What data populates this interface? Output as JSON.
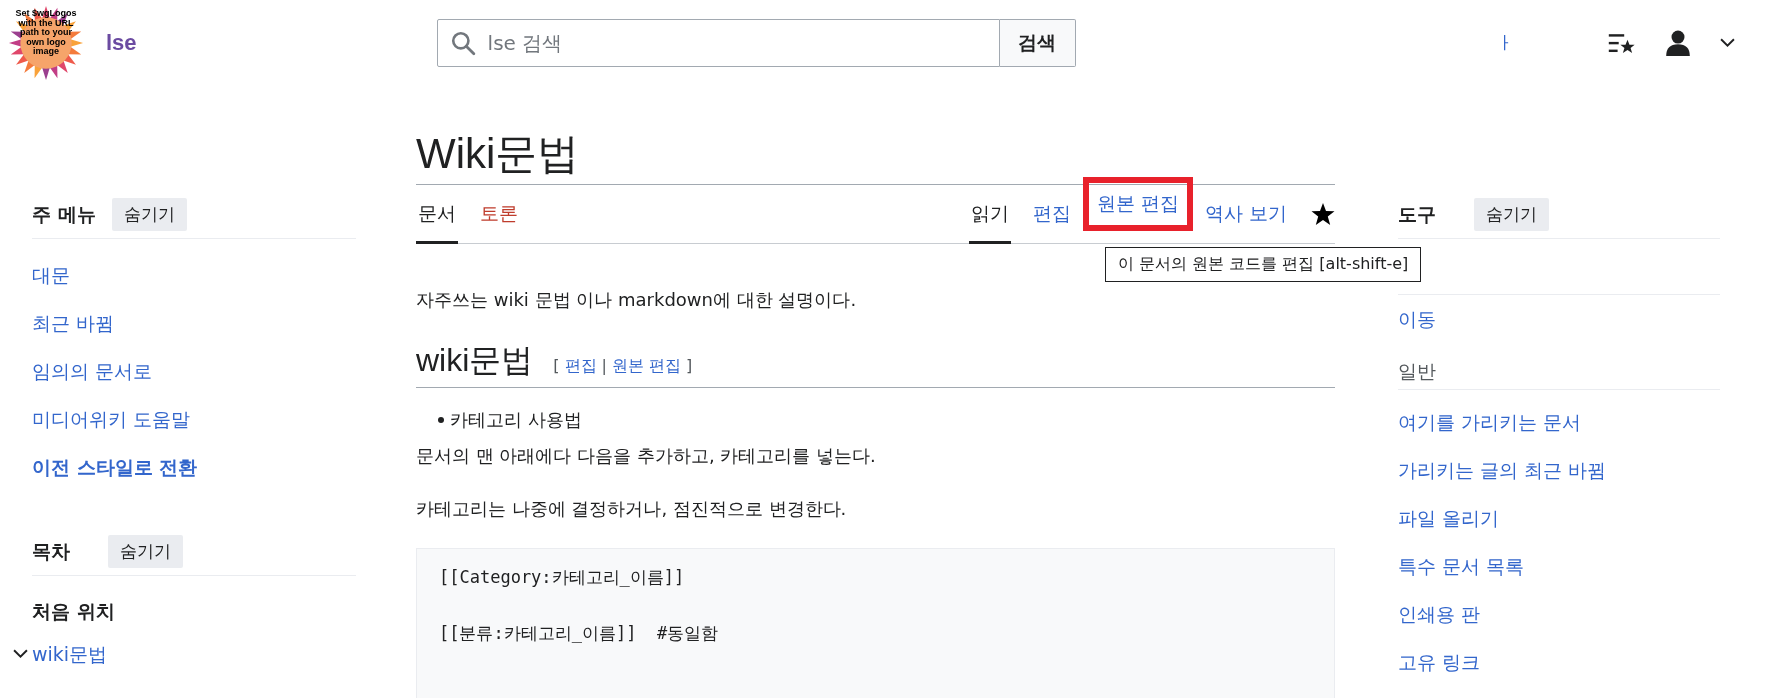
{
  "header": {
    "logo_text": "Set $wgLogos with the URL path to your own logo image",
    "site_name": "lse",
    "search": {
      "placeholder": "lse 검색",
      "button": "검색"
    },
    "partial_link": "ㅏ"
  },
  "main_menu": {
    "title": "주 메뉴",
    "hide": "숨기기",
    "items": [
      {
        "label": "대문",
        "bold": false
      },
      {
        "label": "최근 바뀜",
        "bold": false
      },
      {
        "label": "임의의 문서로",
        "bold": false
      },
      {
        "label": "미디어위키 도움말",
        "bold": false
      },
      {
        "label": "이전 스타일로 전환",
        "bold": true
      }
    ]
  },
  "toc": {
    "title": "목차",
    "hide": "숨기기",
    "top": "처음 위치",
    "items": [
      {
        "label": "wiki문법",
        "expanded": true
      }
    ]
  },
  "page": {
    "title": "Wiki문법",
    "namespace_tabs": [
      {
        "label": "문서",
        "selected": true,
        "missing": false
      },
      {
        "label": "토론",
        "selected": false,
        "missing": true
      }
    ],
    "view_tabs": [
      {
        "label": "읽기",
        "selected": true,
        "highlighted": false
      },
      {
        "label": "편집",
        "selected": false,
        "highlighted": false
      },
      {
        "label": "원본 편집",
        "selected": false,
        "highlighted": true
      },
      {
        "label": "역사 보기",
        "selected": false,
        "highlighted": false
      }
    ],
    "tooltip": "이 문서의 원본 코드를 편집 [alt-shift-e]",
    "intro": "자주쓰는 wiki 문법 이나 markdown에 대한 설명이다.",
    "section": {
      "heading": "wiki문법",
      "open": "[",
      "edit_links": [
        "편집",
        "원본 편집"
      ],
      "separator": "|",
      "close": "]"
    },
    "bullets": [
      "카테고리 사용법"
    ],
    "paragraphs": [
      "문서의 맨 아래에다 다음을 추가하고, 카테고리를 넣는다.",
      "카테고리는 나중에 결정하거나, 점진적으로 변경한다."
    ],
    "code_lines": [
      "[[Category:카테고리_이름]]",
      "[[분류:카테고리_이름]]  #동일함"
    ]
  },
  "tools": {
    "title": "도구",
    "hide": "숨기기",
    "items": [
      {
        "label": "이동",
        "kind": "link"
      },
      {
        "label": "일반",
        "kind": "heading"
      },
      {
        "label": "여기를 가리키는 문서",
        "kind": "link"
      },
      {
        "label": "가리키는 글의 최근 바뀜",
        "kind": "link"
      },
      {
        "label": "파일 올리기",
        "kind": "link"
      },
      {
        "label": "특수 문서 목록",
        "kind": "link"
      },
      {
        "label": "인쇄용 판",
        "kind": "link"
      },
      {
        "label": "고유 링크",
        "kind": "link"
      }
    ]
  }
}
